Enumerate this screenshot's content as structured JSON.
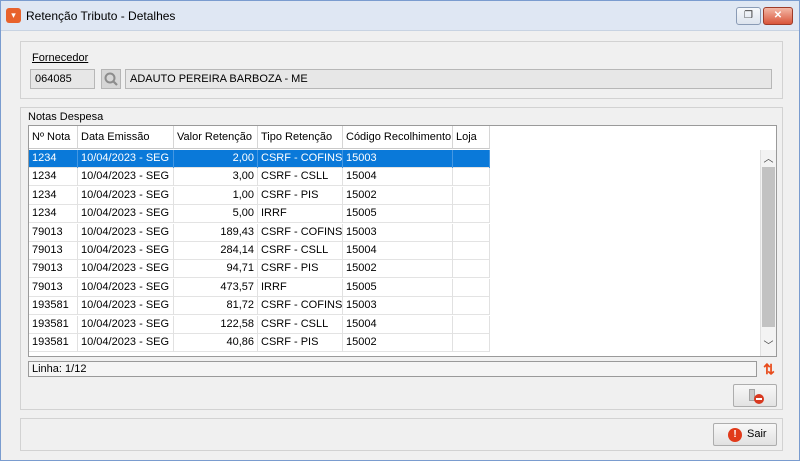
{
  "window": {
    "title": "Retenção Tributo - Detalhes",
    "restore_glyph": "❐",
    "close_glyph": "✕"
  },
  "fornecedor": {
    "label": "Fornecedor",
    "code": "064085",
    "name": "ADAUTO PEREIRA BARBOZA - ME"
  },
  "notas": {
    "label": "Notas Despesa",
    "columns": [
      "Nº Nota",
      "Data Emissão",
      "Valor Retenção",
      "Tipo Retenção",
      "Código Recolhimento",
      "Loja"
    ],
    "rows": [
      {
        "nota": "1234",
        "data": "10/04/2023 - SEG",
        "valor": "2,00",
        "tipo": "CSRF - COFINS",
        "codigo": "15003",
        "loja": ""
      },
      {
        "nota": "1234",
        "data": "10/04/2023 - SEG",
        "valor": "3,00",
        "tipo": "CSRF - CSLL",
        "codigo": "15004",
        "loja": ""
      },
      {
        "nota": "1234",
        "data": "10/04/2023 - SEG",
        "valor": "1,00",
        "tipo": "CSRF - PIS",
        "codigo": "15002",
        "loja": ""
      },
      {
        "nota": "1234",
        "data": "10/04/2023 - SEG",
        "valor": "5,00",
        "tipo": "IRRF",
        "codigo": "15005",
        "loja": ""
      },
      {
        "nota": "79013",
        "data": "10/04/2023 - SEG",
        "valor": "189,43",
        "tipo": "CSRF - COFINS",
        "codigo": "15003",
        "loja": ""
      },
      {
        "nota": "79013",
        "data": "10/04/2023 - SEG",
        "valor": "284,14",
        "tipo": "CSRF - CSLL",
        "codigo": "15004",
        "loja": ""
      },
      {
        "nota": "79013",
        "data": "10/04/2023 - SEG",
        "valor": "94,71",
        "tipo": "CSRF - PIS",
        "codigo": "15002",
        "loja": ""
      },
      {
        "nota": "79013",
        "data": "10/04/2023 - SEG",
        "valor": "473,57",
        "tipo": "IRRF",
        "codigo": "15005",
        "loja": ""
      },
      {
        "nota": "193581",
        "data": "10/04/2023 - SEG",
        "valor": "81,72",
        "tipo": "CSRF - COFINS",
        "codigo": "15003",
        "loja": ""
      },
      {
        "nota": "193581",
        "data": "10/04/2023 - SEG",
        "valor": "122,58",
        "tipo": "CSRF - CSLL",
        "codigo": "15004",
        "loja": ""
      },
      {
        "nota": "193581",
        "data": "10/04/2023 - SEG",
        "valor": "40,86",
        "tipo": "CSRF - PIS",
        "codigo": "15002",
        "loja": ""
      }
    ],
    "selected_index": 0,
    "status": "Linha: 1/12"
  },
  "buttons": {
    "sair_label": "Sair"
  },
  "colors": {
    "selection": "#0a79d9",
    "accent": "#e8622c"
  }
}
